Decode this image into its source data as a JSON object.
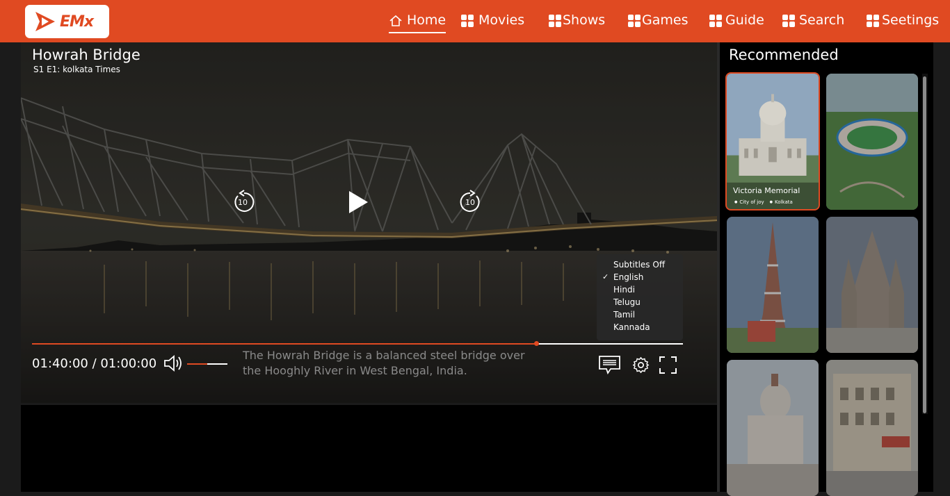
{
  "app": {
    "logo_text": "EMx",
    "brand_color": "#e04a22"
  },
  "nav": {
    "items": [
      {
        "label": "Home",
        "icon": "home-icon",
        "active": true
      },
      {
        "label": "Movies",
        "icon": "grid-icon"
      },
      {
        "label": "Shows",
        "icon": "grid-icon"
      },
      {
        "label": "Games",
        "icon": "grid-icon"
      },
      {
        "label": "Guide",
        "icon": "grid-icon"
      },
      {
        "label": "Search",
        "icon": "grid-icon"
      },
      {
        "label": "Seetings",
        "icon": "grid-icon"
      }
    ]
  },
  "player": {
    "title": "Howrah Bridge",
    "episode": "S1 E1: kolkata Times",
    "rewind_label": "10",
    "forward_label": "10",
    "time_display": "01:40:00 / 01:00:00",
    "progress": 0.775,
    "volume": 0.5,
    "description": "The Howrah Bridge is a balanced steel bridge over the Hooghly River in West Bengal, India.",
    "subtitles": {
      "options": [
        "Subtitles Off",
        "English",
        "Hindi",
        "Telugu",
        "Tamil",
        "Kannada"
      ],
      "selected": "English"
    }
  },
  "sidebar": {
    "title": "Recommended",
    "cards": [
      {
        "caption": "Victoria Memorial",
        "tags": [
          "City of joy",
          "Kolkata"
        ],
        "selected": true
      },
      {
        "caption": ""
      },
      {
        "caption": ""
      },
      {
        "caption": ""
      },
      {
        "caption": ""
      },
      {
        "caption": ""
      }
    ]
  }
}
